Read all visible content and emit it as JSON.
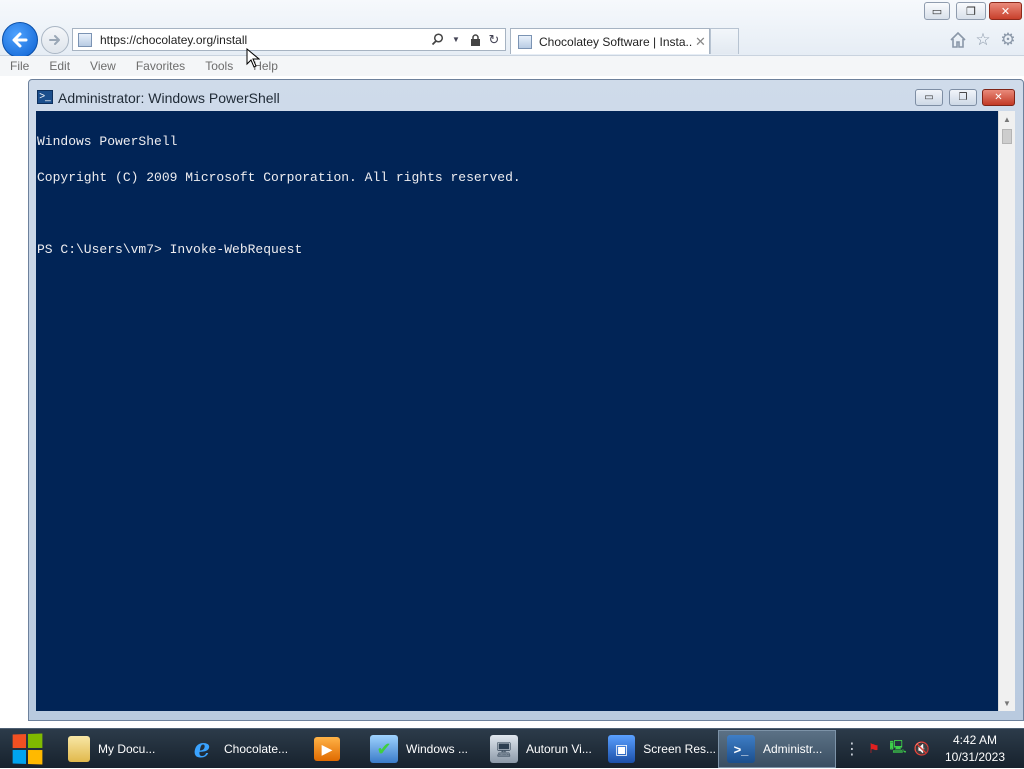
{
  "browser": {
    "address_url": "https://chocolatey.org/install",
    "tab_title": "Chocolatey Software | Insta...",
    "tab_close": "✕",
    "menu": [
      "File",
      "Edit",
      "View",
      "Favorites",
      "Tools",
      "Help"
    ],
    "caption": {
      "minimize": "▭",
      "restore": "❐",
      "close": "✕"
    }
  },
  "powershell": {
    "title": "Administrator: Windows PowerShell",
    "caption": {
      "minimize": "▭",
      "restore": "❐",
      "close": "✕"
    },
    "lines": [
      "Windows PowerShell",
      "Copyright (C) 2009 Microsoft Corporation. All rights reserved.",
      "",
      "PS C:\\Users\\vm7> Invoke-WebRequest"
    ],
    "colors": {
      "background": "#012456",
      "text": "#eeedf0"
    }
  },
  "taskbar": {
    "items": [
      {
        "label": "My Docu...",
        "icon": "folder-icon"
      },
      {
        "label": "Chocolate...",
        "icon": "internet-explorer-icon"
      },
      {
        "label": "",
        "icon": "media-player-icon"
      },
      {
        "label": "Windows ...",
        "icon": "windows-installer-icon"
      },
      {
        "label": "Autorun Vi...",
        "icon": "autorun-viewer-icon"
      },
      {
        "label": "Screen Res...",
        "icon": "screen-resolution-icon"
      },
      {
        "label": "Administr...",
        "icon": "powershell-icon"
      }
    ],
    "clock_time": "4:42 AM",
    "clock_date": "10/31/2023"
  }
}
